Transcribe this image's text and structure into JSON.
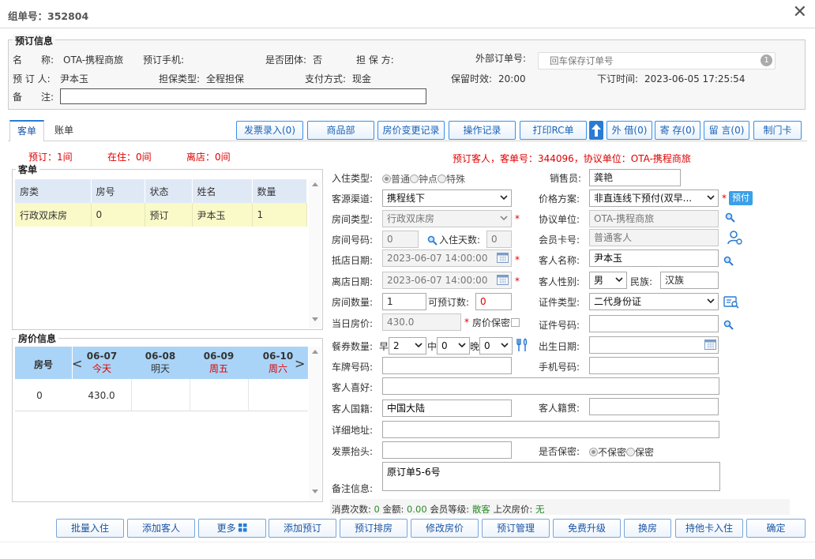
{
  "window": {
    "title": "组单号：352804"
  },
  "booking": {
    "legend": "预订信息",
    "name_label": "名　　称:",
    "name_value": "OTA-携程商旅",
    "phone_label": "预订手机:",
    "group_label": "是否团体:",
    "group_value": "否",
    "guarantor_label": "担 保 方:",
    "ext_order_label": "外部订单号:",
    "ext_order_placeholder": "回车保存订单号",
    "ext_order_badge": "1",
    "booker_label": "预 订 人:",
    "booker_value": "尹本玉",
    "guarantee_type_label": "担保类型:",
    "guarantee_type_value": "全程担保",
    "payment_label": "支付方式:",
    "payment_value": "现金",
    "hold_label": "保留时效:",
    "hold_value": "20:00",
    "order_time_label": "下订时间:",
    "order_time_value": "2023-06-05 17:25:54",
    "remark_label": "备　　注:",
    "remark_value": ""
  },
  "tabs": [
    "客单",
    "账单"
  ],
  "toolbar": [
    "发票录入(0)",
    "商品部",
    "房价变更记录",
    "操作记录",
    "打印RC单",
    "外 借(0)",
    "寄 存(0)",
    "留 言(0)",
    "制门卡"
  ],
  "stats": {
    "reserved": "预订：1间",
    "in_house": "在住：0间",
    "left": "离店：0间",
    "summary": "预订客人，客单号：344096，协议单位：OTA-携程商旅"
  },
  "guest_list": {
    "legend": "客单",
    "columns": [
      "房类",
      "房号",
      "状态",
      "姓名",
      "数量"
    ],
    "rows": [
      [
        "行政双床房",
        "0",
        "预订",
        "尹本玉",
        "1"
      ]
    ]
  },
  "rate_info": {
    "legend": "房价信息",
    "room_col": "房号",
    "days": [
      {
        "date": "06-07",
        "sub": "今天",
        "red": true
      },
      {
        "date": "06-08",
        "sub": "明天",
        "red": false
      },
      {
        "date": "06-09",
        "sub": "周五",
        "red": true
      },
      {
        "date": "06-10",
        "sub": "周六",
        "red": true
      }
    ],
    "room": "0",
    "prices": [
      "430.0",
      "",
      "",
      ""
    ]
  },
  "form": {
    "checkin_type_label": "入住类型:",
    "checkin_types": [
      "普通",
      "钟点",
      "特殊"
    ],
    "sales_label": "销售员:",
    "sales_value": "龚艳",
    "channel_label": "客源渠道:",
    "channel_value": "携程线下",
    "price_plan_label": "价格方案:",
    "price_plan_value": "非直连线下预付(双早...",
    "prepay_badge": "预付",
    "room_type_label": "房间类型:",
    "room_type_value": "行政双床房",
    "agreement_label": "协议单位:",
    "agreement_value": "OTA-携程商旅",
    "room_no_label": "房间号码:",
    "room_no_value": "0",
    "nights_label": "入住天数:",
    "nights_value": "0",
    "member_label": "会员卡号:",
    "member_value": "普通客人",
    "arrive_label": "抵店日期:",
    "arrive_value": "2023-06-07 14:00:00",
    "guest_name_label": "客人名称:",
    "guest_name_value": "尹本玉",
    "depart_label": "离店日期:",
    "depart_value": "2023-06-07 14:00:00",
    "gender_label": "客人性别:",
    "gender_value": "男",
    "ethnic_label": "民族:",
    "ethnic_value": "汉族",
    "room_count_label": "房间数量:",
    "room_count_value": "1",
    "avail_label": "可预订数:",
    "avail_value": "0",
    "id_type_label": "证件类型:",
    "id_type_value": "二代身份证",
    "day_rate_label": "当日房价:",
    "day_rate_value": "430.0",
    "rate_secret_label": "房价保密",
    "id_no_label": "证件号码:",
    "meal_label": "餐券数量:",
    "breakfast_label": "早",
    "breakfast_value": "2",
    "lunch_label": "中",
    "lunch_value": "0",
    "dinner_label": "晚",
    "dinner_value": "0",
    "birth_label": "出生日期:",
    "plate_label": "车牌号码:",
    "mobile_label": "手机号码:",
    "pref_label": "客人喜好:",
    "nation_label": "客人国籍:",
    "nation_value": "中国大陆",
    "native_label": "客人籍贯:",
    "address_label": "详细地址:",
    "invoice_label": "发票抬头:",
    "secret_label": "是否保密:",
    "secret_options": [
      "不保密",
      "保密"
    ],
    "remark_label": "备注信息:",
    "remark_value": "原订单5-6号"
  },
  "consume": {
    "count_label": "消费次数:",
    "count_value": "0",
    "amount_label": "金额:",
    "amount_value": "0.00",
    "level_label": "会员等级:",
    "level_value": "散客",
    "last_rate_label": "上次房价:",
    "last_rate_value": "无"
  },
  "bottom_buttons": [
    "批量入住",
    "添加客人",
    "更多",
    "添加预订",
    "预订排房",
    "修改房价",
    "预订管理",
    "免费升级",
    "换房",
    "持他卡入住",
    "确定"
  ]
}
